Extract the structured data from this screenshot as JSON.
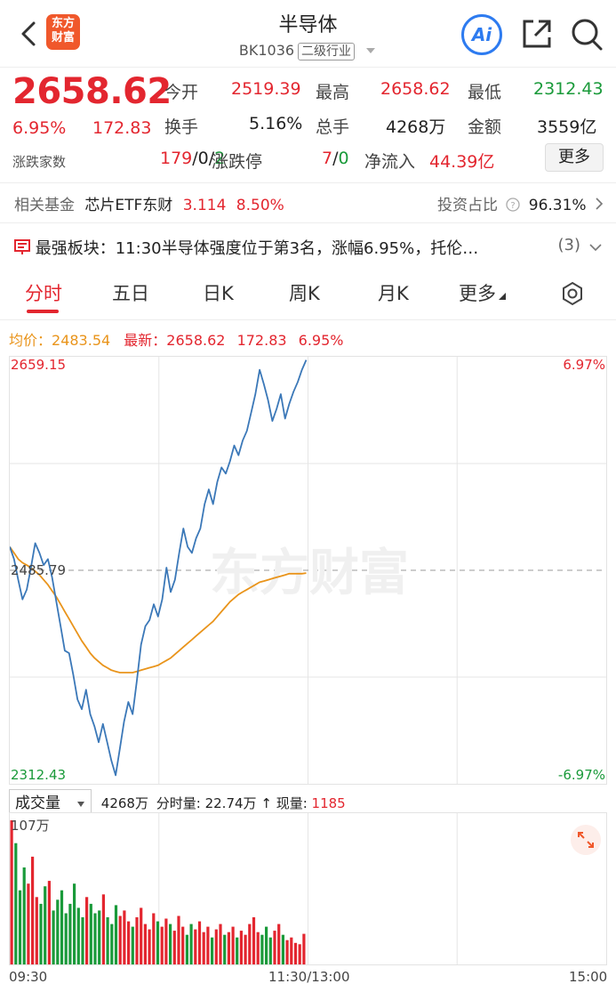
{
  "header": {
    "title": "半导体",
    "code": "BK1036",
    "tag": "二级行业",
    "logo_text": "东方财富",
    "ai_label": "Ai"
  },
  "quote": {
    "price": "2658.62",
    "change_pct": "6.95%",
    "change": "172.83",
    "open_label": "今开",
    "open": "2519.39",
    "high_label": "最高",
    "high": "2658.62",
    "low_label": "最低",
    "low": "2312.43",
    "turnover_label": "换手",
    "turnover": "5.16%",
    "volume_label": "总手",
    "volume": "4268万",
    "amount_label": "金额",
    "amount": "3559亿",
    "count_label": "涨跌家数",
    "count_up": "179",
    "count_flat": "0",
    "count_down": "2",
    "limit_label": "涨跌停",
    "limit_up": "7",
    "limit_down": "0",
    "inflow_label": "净流入",
    "inflow": "44.39亿",
    "more_label": "更多"
  },
  "fund": {
    "label": "相关基金",
    "name": "芯片ETF东财",
    "price": "3.114",
    "pct": "8.50%",
    "ratio_label": "投资占比",
    "ratio": "96.31%"
  },
  "strong": {
    "label": "最强板块：",
    "text": "11:30半导体强度位于第3名，涨幅6.95%，托伦…",
    "count": "(3)"
  },
  "tabs": [
    "分时",
    "五日",
    "日K",
    "周K",
    "月K",
    "更多"
  ],
  "avg_row": {
    "avg_label": "均价：",
    "avg": "2483.54",
    "latest_label": "最新：",
    "latest": "2658.62",
    "change": "172.83",
    "pct": "6.95%"
  },
  "axis": {
    "top_price": "2659.15",
    "mid_price": "2485.79",
    "bottom_price": "2312.43",
    "top_pct": "6.97%",
    "bottom_pct": "-6.97%",
    "watermark": "东方财富"
  },
  "volume": {
    "select": "成交量",
    "total": "4268万",
    "tick_label": "分时量:",
    "tick": "22.74万",
    "now_label": "现量:",
    "now": "1185",
    "max": "107万"
  },
  "times": [
    "09:30",
    "11:30/13:00",
    "15:00"
  ],
  "colors": {
    "up": "#e3262f",
    "down": "#1a9a3a",
    "avg": "#e9941b",
    "price_line": "#3b78b8"
  },
  "chart_data": {
    "type": "line",
    "ylim": [
      2312.43,
      2659.15
    ],
    "prev_close": 2485.79,
    "series": [
      {
        "name": "最新",
        "values": [
          2505,
          2495,
          2478,
          2462,
          2470,
          2488,
          2508,
          2500,
          2490,
          2495,
          2480,
          2460,
          2440,
          2420,
          2418,
          2400,
          2380,
          2372,
          2388,
          2368,
          2358,
          2345,
          2360,
          2345,
          2330,
          2318,
          2340,
          2362,
          2378,
          2368,
          2395,
          2425,
          2440,
          2445,
          2458,
          2448,
          2462,
          2488,
          2468,
          2478,
          2500,
          2520,
          2505,
          2500,
          2512,
          2520,
          2540,
          2552,
          2540,
          2558,
          2570,
          2565,
          2575,
          2588,
          2580,
          2592,
          2600,
          2615,
          2630,
          2650,
          2638,
          2625,
          2608,
          2618,
          2630,
          2610,
          2622,
          2632,
          2640,
          2650,
          2658
        ]
      },
      {
        "name": "均价",
        "values": [
          2505,
          2500,
          2495,
          2492,
          2490,
          2488,
          2485,
          2482,
          2478,
          2474,
          2469,
          2464,
          2458,
          2452,
          2446,
          2440,
          2434,
          2428,
          2423,
          2418,
          2414,
          2411,
          2408,
          2406,
          2404,
          2403,
          2402,
          2402,
          2402,
          2402,
          2403,
          2404,
          2405,
          2406,
          2407,
          2408,
          2410,
          2412,
          2414,
          2417,
          2420,
          2423,
          2426,
          2429,
          2432,
          2435,
          2438,
          2441,
          2444,
          2448,
          2452,
          2456,
          2460,
          2463,
          2466,
          2468,
          2470,
          2472,
          2474,
          2476,
          2477,
          2478,
          2479,
          2480,
          2481,
          2482,
          2483,
          2483,
          2483,
          2483,
          2483.54
        ]
      }
    ],
    "volume_values": [
      107,
      90,
      55,
      72,
      60,
      80,
      50,
      45,
      58,
      62,
      40,
      48,
      55,
      38,
      45,
      60,
      42,
      35,
      50,
      45,
      38,
      40,
      52,
      35,
      30,
      44,
      36,
      40,
      32,
      28,
      35,
      42,
      30,
      26,
      38,
      32,
      28,
      34,
      30,
      25,
      36,
      28,
      22,
      30,
      26,
      32,
      24,
      28,
      20,
      26,
      30,
      22,
      24,
      28,
      20,
      25,
      22,
      30,
      35,
      24,
      22,
      28,
      20,
      25,
      30,
      22,
      18,
      20,
      16,
      15,
      22.74
    ]
  }
}
